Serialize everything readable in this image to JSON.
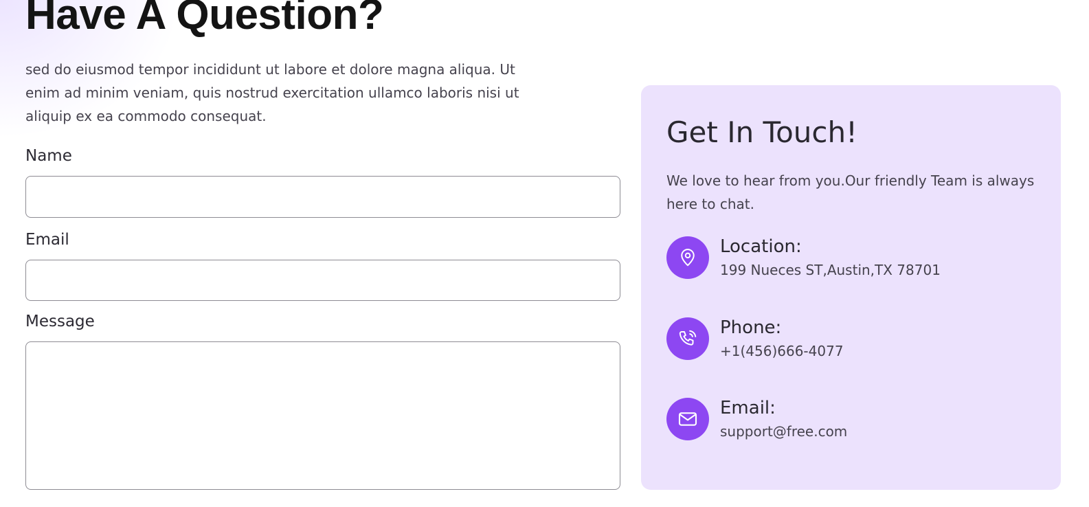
{
  "form_section": {
    "heading": "Have A Question?",
    "intro": "sed do eiusmod tempor incididunt ut labore et dolore magna aliqua. Ut enim ad minim veniam, quis nostrud exercitation ullamco laboris nisi ut aliquip ex ea commodo consequat.",
    "name_label": "Name",
    "name_value": "",
    "email_label": "Email",
    "email_value": "",
    "message_label": "Message",
    "message_value": ""
  },
  "contact_card": {
    "title": "Get In Touch!",
    "text": "We love to hear from you.Our friendly Team is always here to chat.",
    "items": [
      {
        "icon": "location-pin-icon",
        "title": "Location:",
        "value": "199 Nueces ST,Austin,TX 78701"
      },
      {
        "icon": "phone-icon",
        "title": "Phone:",
        "value": "+1(456)666-4077"
      },
      {
        "icon": "envelope-icon",
        "title": "Email:",
        "value": "support@free.com"
      }
    ]
  },
  "colors": {
    "accent": "#8d47f2",
    "card_background": "#ece2fd",
    "heading": "#141414",
    "body_text": "#45424d"
  }
}
